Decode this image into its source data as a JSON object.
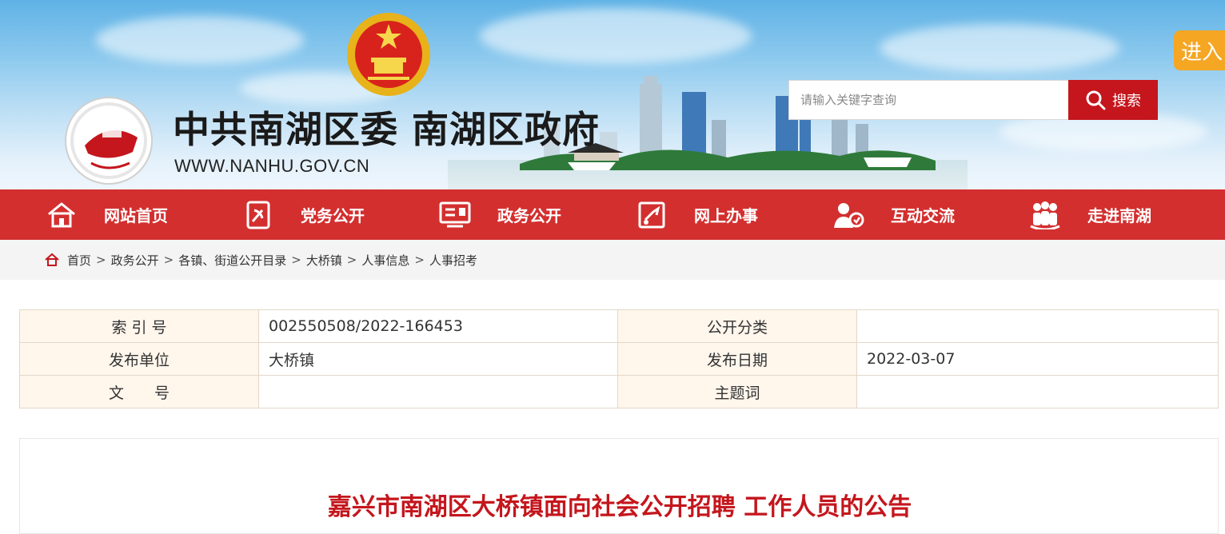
{
  "header": {
    "title": "中共南湖区委 南湖区政府",
    "url": "WWW.NANHU.GOV.CN",
    "enter_label": "进入",
    "search": {
      "placeholder": "请输入关键字查询",
      "button_label": "搜索",
      "icon": "search-icon"
    },
    "brand_color": "#d32f2f"
  },
  "nav": {
    "items": [
      {
        "label": "网站首页",
        "icon": "home-icon"
      },
      {
        "label": "党务公开",
        "icon": "party-flag-icon"
      },
      {
        "label": "政务公开",
        "icon": "gov-screen-icon"
      },
      {
        "label": "网上办事",
        "icon": "online-service-icon"
      },
      {
        "label": "互动交流",
        "icon": "interaction-icon"
      },
      {
        "label": "走进南湖",
        "icon": "people-group-icon"
      }
    ]
  },
  "breadcrumb": {
    "items": [
      "首页",
      "政务公开",
      "各镇、街道公开目录",
      "大桥镇",
      "人事信息",
      "人事招考"
    ],
    "separator": ">"
  },
  "meta": {
    "rows": [
      {
        "label1": "索 引 号",
        "value1": "002550508/2022-166453",
        "label2": "公开分类",
        "value2": ""
      },
      {
        "label1": "发布单位",
        "value1": "大桥镇",
        "label2": "发布日期",
        "value2": "2022-03-07"
      },
      {
        "label1": "文　　号",
        "value1": "",
        "label2": "主题词",
        "value2": ""
      }
    ]
  },
  "article": {
    "title": "嘉兴市南湖区大桥镇面向社会公开招聘 工作人员的公告"
  }
}
